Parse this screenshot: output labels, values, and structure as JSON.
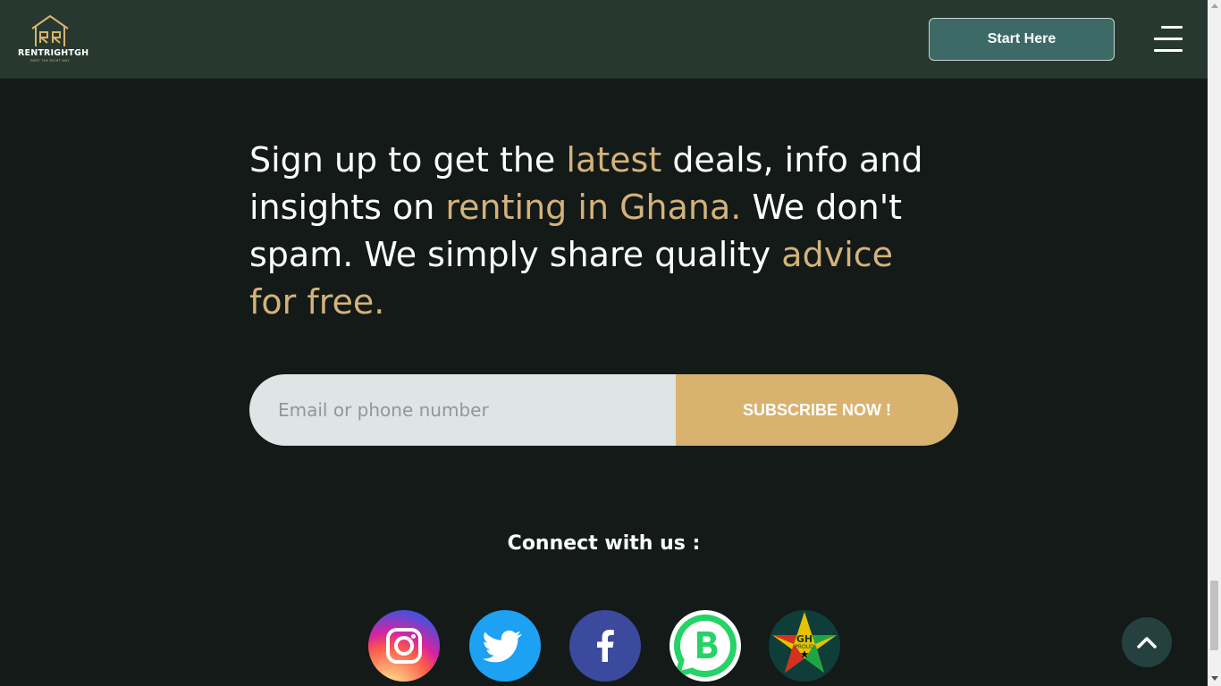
{
  "header": {
    "logo_text": "RENTRIGHTGH",
    "logo_tagline": "RENT THE RIGHT WAY",
    "start_button": "Start Here",
    "menu_icon": "hamburger-menu-icon"
  },
  "signup": {
    "parts": [
      {
        "text": "Sign up to get the ",
        "accent": false
      },
      {
        "text": "latest",
        "accent": true
      },
      {
        "text": " deals, info and insights on ",
        "accent": false
      },
      {
        "text": "renting in Ghana.",
        "accent": true
      },
      {
        "text": " We don't spam. We simply share quality ",
        "accent": false
      },
      {
        "text": "advice for free.",
        "accent": true
      }
    ],
    "input_placeholder": "Email or phone number",
    "subscribe_label": "SUBSCRIBE NOW !"
  },
  "connect": {
    "title": "Connect with us :",
    "socials": [
      {
        "name": "instagram",
        "icon": "instagram-icon"
      },
      {
        "name": "twitter",
        "icon": "twitter-icon"
      },
      {
        "name": "facebook",
        "icon": "facebook-icon"
      },
      {
        "name": "whatsapp-business",
        "icon": "whatsapp-business-icon"
      },
      {
        "name": "gh-proud",
        "icon": "gh-proud-icon",
        "label": "GH",
        "sublabel": "PROUD"
      }
    ]
  },
  "colors": {
    "background": "#131a18",
    "header": "#263830",
    "accent": "#d4b27a",
    "button": "#3d6a67",
    "subscribe": "#d9b26f"
  }
}
